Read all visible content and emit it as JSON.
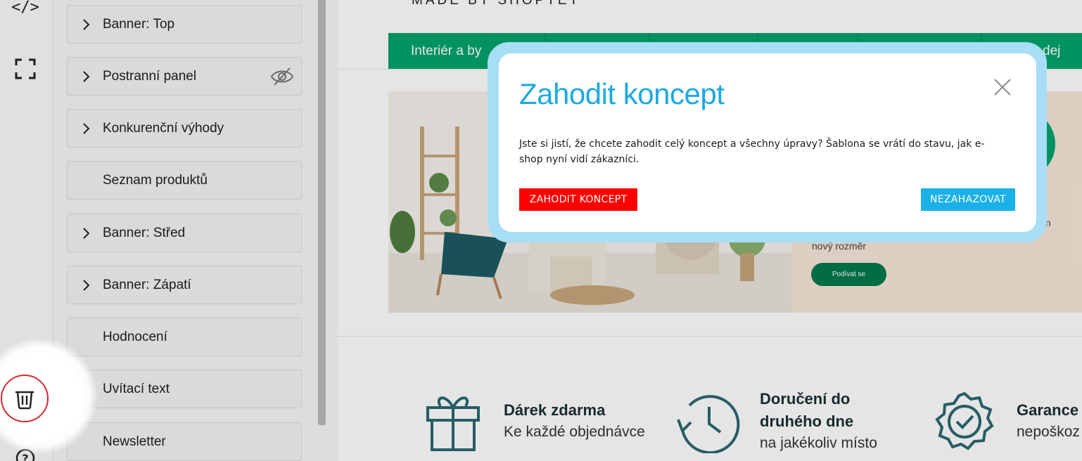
{
  "rail": {
    "code_glyph": "</>"
  },
  "sections": [
    {
      "label": "Banner: Top",
      "expandable": true
    },
    {
      "label": "Postranní panel",
      "expandable": true,
      "hidden": true
    },
    {
      "label": "Konkurenční výhody",
      "expandable": true
    },
    {
      "label": "Seznam produktů",
      "expandable": false
    },
    {
      "label": "Banner: Střed",
      "expandable": true
    },
    {
      "label": "Banner: Zápatí",
      "expandable": true
    },
    {
      "label": "Hodnocení",
      "expandable": false
    },
    {
      "label": "Uvítací text",
      "expandable": false
    },
    {
      "label": "Newsletter",
      "expandable": false
    }
  ],
  "preview": {
    "made_by": "MADE BY SHOPTET",
    "nav_first": "Interiér a by",
    "nav_last": "dej",
    "hero_text": "nový rozměr",
    "hero_text_right": "n",
    "hero_button": "Podívat se",
    "benefits": [
      {
        "title": "Dárek zdarma",
        "subtitle": "Ke každé objednávce"
      },
      {
        "title": "Doručení do druhého dne",
        "title_line1": "Doručení do",
        "title_line2": "druhého dne",
        "subtitle": "na jakékoliv místo"
      },
      {
        "title": "Garance",
        "subtitle": "nepoškoz"
      }
    ],
    "brand_green": "#00a36c"
  },
  "modal": {
    "title": "Zahodit koncept",
    "body": "Jste si jistí, že chcete zahodit celý koncept a všechny úpravy? Šablona se vrátí do stavu, jak e-shop nyní vidí zákazníci.",
    "discard_label": "ZAHODIT KONCEPT",
    "keep_label": "NEZAHAZOVAT",
    "title_color": "#1da9e3",
    "discard_color": "#ff0000",
    "keep_color": "#1ab0e8"
  }
}
